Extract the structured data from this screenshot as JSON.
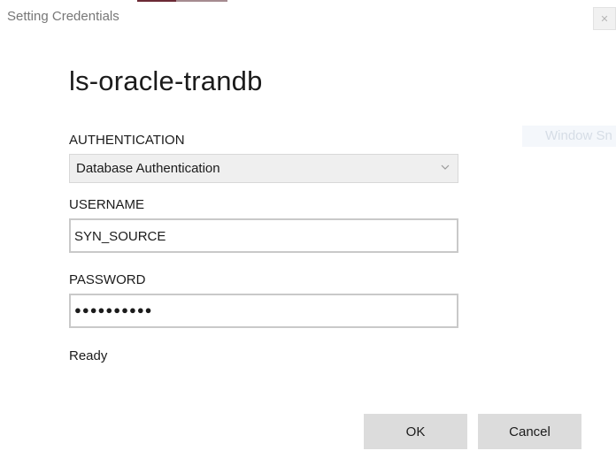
{
  "window": {
    "title": "Setting Credentials",
    "close_glyph": "✕"
  },
  "background": {
    "ghost_text": "Window Sn"
  },
  "dialog": {
    "heading": "ls-oracle-trandb",
    "authentication": {
      "label": "AUTHENTICATION",
      "selected": "Database Authentication",
      "icon": "chevron-down-icon"
    },
    "username": {
      "label": "USERNAME",
      "value": "SYN_SOURCE"
    },
    "password": {
      "label": "PASSWORD",
      "masked_value": "●●●●●●●●●●"
    },
    "status": "Ready",
    "buttons": {
      "ok": "OK",
      "cancel": "Cancel"
    }
  },
  "colors": {
    "accent_top_1": "#6b2a35",
    "accent_top_2": "#a58b90",
    "button_bg": "#dcdcdc",
    "select_bg": "#efefef"
  }
}
